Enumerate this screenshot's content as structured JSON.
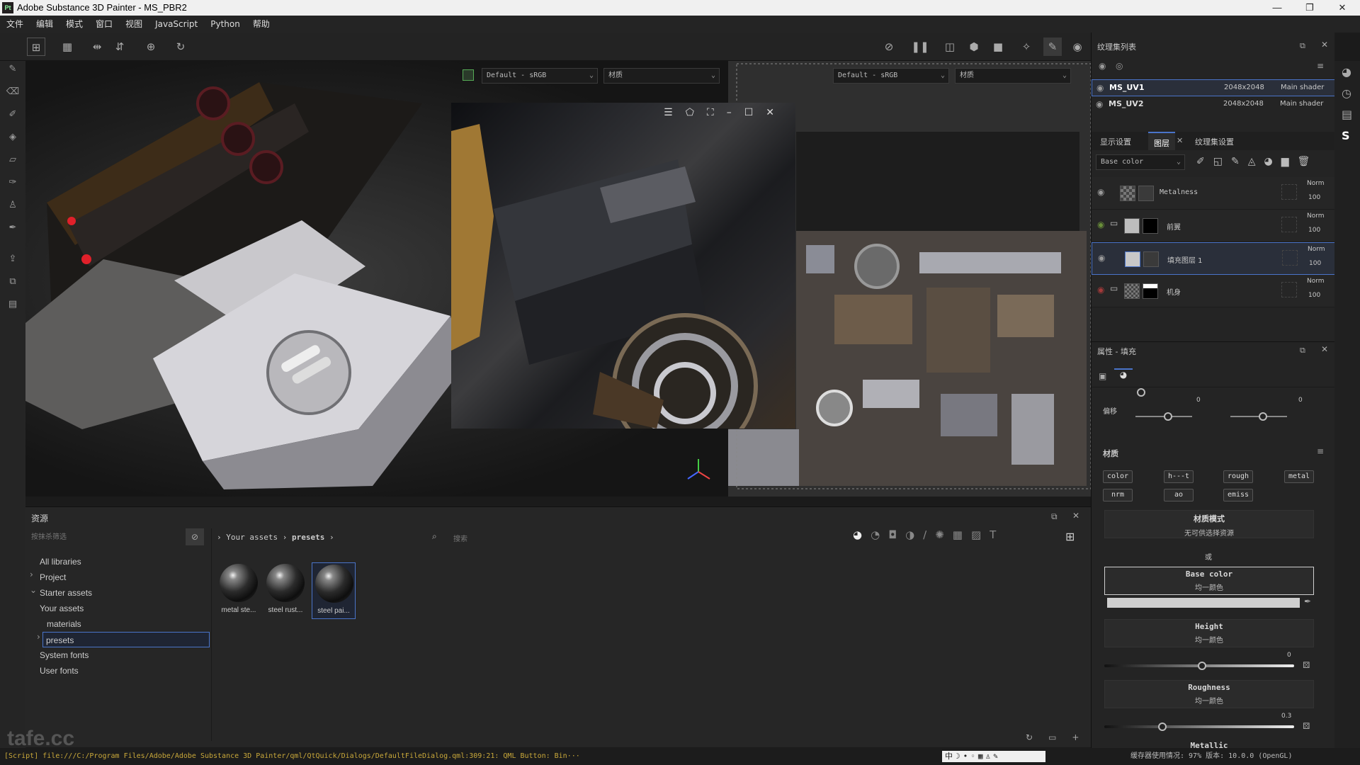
{
  "window": {
    "title": "Adobe Substance 3D Painter - MS_PBR2",
    "logo": "Pt"
  },
  "menu": [
    "文件",
    "编辑",
    "模式",
    "窗口",
    "视图",
    "JavaScript",
    "Python",
    "帮助"
  ],
  "viewport": {
    "left_colorspace": "Default - sRGB",
    "left_channel": "材质",
    "right_colorspace": "Default - sRGB",
    "right_channel": "材质"
  },
  "texture_set_list": {
    "title": "纹理集列表",
    "sets": [
      {
        "name": "MS_UV1",
        "size": "2048x2048",
        "shader": "Main shader"
      },
      {
        "name": "MS_UV2",
        "size": "2048x2048",
        "shader": "Main shader"
      }
    ]
  },
  "layers_tabs": {
    "display_settings": "显示设置",
    "layers": "图层",
    "texture_settings": "纹理集设置"
  },
  "channel_select": "Base color",
  "layers": [
    {
      "name": "Metalness",
      "blend": "Norm",
      "opacity": "100"
    },
    {
      "name": "前翼",
      "blend": "Norm",
      "opacity": "100"
    },
    {
      "name": "填充图层 1",
      "blend": "Norm",
      "opacity": "100"
    },
    {
      "name": "机身",
      "blend": "Norm",
      "opacity": "100"
    }
  ],
  "properties": {
    "title": "属性 - 填充",
    "offset_label": "偏移",
    "offset_values": [
      "0",
      "0"
    ],
    "material_title": "材质",
    "chips": [
      "color",
      "h---t",
      "rough",
      "metal",
      "nrm",
      "ao",
      "emiss"
    ],
    "material_mode": "材质模式",
    "material_mode_sub": "无可供选择资源",
    "or_label": "或",
    "base_color_title": "Base color",
    "base_color_sub": "均一颜色",
    "height_title": "Height",
    "height_sub": "均一颜色",
    "height_value": "0",
    "roughness_title": "Roughness",
    "roughness_sub": "均一颜色",
    "roughness_value": "0.3",
    "metallic_title": "Metallic"
  },
  "assets": {
    "title": "资源",
    "filter_placeholder": "按抹杀筛选",
    "tree": [
      "All libraries",
      "Project",
      "Starter assets",
      "Your assets",
      "materials",
      "presets",
      "System fonts",
      "User fonts"
    ],
    "breadcrumb": [
      "Your assets",
      "presets"
    ],
    "search_placeholder": "搜索",
    "thumbs": [
      "metal ste...",
      "steel rust...",
      "steel pai..."
    ]
  },
  "status": {
    "script": "[Script] file:///C:/Program Files/Adobe/Adobe Substance 3D Painter/qml/QtQuick/Dialogs/DefaultFileDialog.qml:309:21: QML Button: Bin···",
    "right": "缓存器使用情况: 97%   版本: 10.0.0 (OpenGL)"
  },
  "watermark": "tafe.cc",
  "colors": {
    "selected": "#4a74c9",
    "eye_green": "#6a8f3a",
    "eye_red": "#a33a3a"
  }
}
